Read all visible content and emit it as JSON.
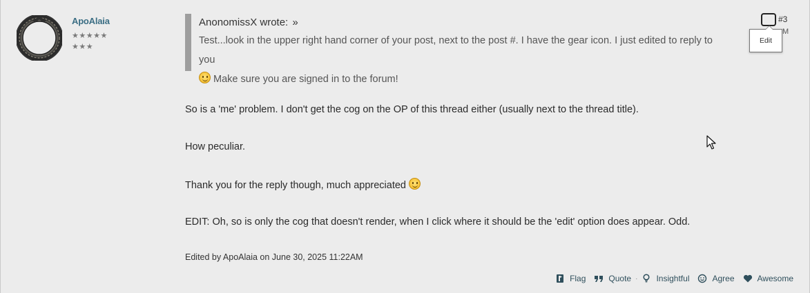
{
  "author": {
    "name": "ApoAlaia",
    "stars_row1": "★★★★★",
    "stars_row2": "★★★"
  },
  "post": {
    "number": "#3",
    "time_fragment": "M",
    "edit_tooltip": "Edit",
    "quote": {
      "author_line": "AnonomissX wrote:",
      "arrow": "»",
      "text_line1": "Test...look in the upper right hand corner of your post, next to the post #. I have the gear icon. I just edited to reply to you",
      "text_line2": "Make sure you are signed in to the forum!"
    },
    "body": {
      "p1": "So is a 'me' problem. I don't get the cog on the OP of this thread either (usually next to the thread title).",
      "p2": "How peculiar.",
      "p3": "Thank you for the reply though, much appreciated",
      "p4": "EDIT: Oh, so is only the cog that doesn't render, when I click where it should be the 'edit' option does appear. Odd."
    },
    "edited_note": "Edited by ApoAlaia on June 30, 2025 11:22AM"
  },
  "reactions": {
    "flag": "Flag",
    "quote": "Quote",
    "separator": "·",
    "insightful": "Insightful",
    "agree": "Agree",
    "awesome": "Awesome"
  },
  "colors": {
    "background": "#ececec",
    "author_link": "#3b6e84",
    "quote_bar": "#9e9e9e",
    "reaction_text": "#2f4f5c"
  }
}
